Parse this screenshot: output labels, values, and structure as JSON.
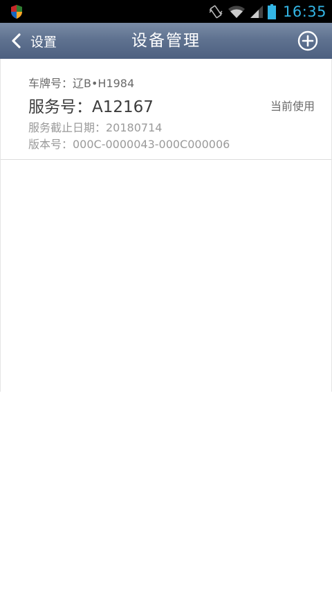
{
  "status_bar": {
    "time": "16:35",
    "icons": [
      "shield-icon",
      "vibrate-icon",
      "wifi-icon",
      "signal-icon",
      "battery-icon"
    ],
    "time_color": "#33b5e5"
  },
  "title_bar": {
    "back_label": "设置",
    "title": "设备管理",
    "add_icon": "plus-circle-icon",
    "background_color": "#5f7290"
  },
  "devices": [
    {
      "plate": "车牌号：辽B•H1984",
      "service": "服务号：A12167",
      "status": "当前使用",
      "expire": "服务截止日期：20180714",
      "version": "版本号：000C-0000043-000C000006"
    }
  ]
}
